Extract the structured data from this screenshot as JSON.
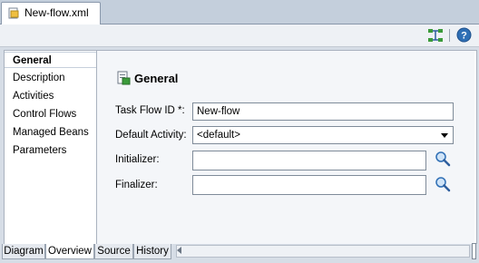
{
  "editor_tab": {
    "label": "New-flow.xml",
    "icon": "xml-file-icon"
  },
  "toolbar": {
    "flow_icon": "task-flow-icon",
    "help_icon": "help-icon"
  },
  "nav": {
    "items": [
      {
        "label": "General"
      },
      {
        "label": "Description"
      },
      {
        "label": "Activities"
      },
      {
        "label": "Control Flows"
      },
      {
        "label": "Managed Beans"
      },
      {
        "label": "Parameters"
      }
    ]
  },
  "general": {
    "title": "General",
    "task_flow_id": {
      "label": "Task Flow ID *:",
      "value": "New-flow"
    },
    "default_activity": {
      "label": "Default Activity:",
      "value": "<default>"
    },
    "initializer": {
      "label": "Initializer:",
      "value": ""
    },
    "finalizer": {
      "label": "Finalizer:",
      "value": ""
    }
  },
  "bottom_tabs": [
    "Diagram",
    "Overview",
    "Source",
    "History"
  ],
  "colors": {
    "accent": "#3a6ea5",
    "selected_tab": "#ffffff",
    "panel_bg": "#f4f6f9"
  }
}
